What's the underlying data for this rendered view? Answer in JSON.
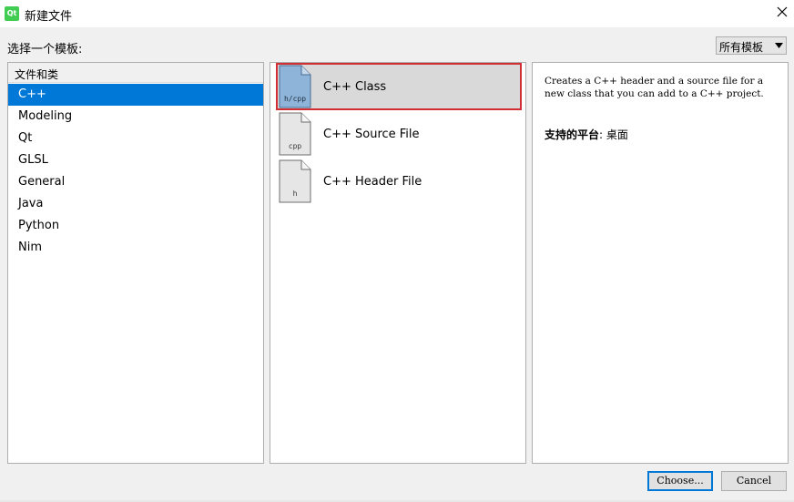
{
  "window": {
    "title": "新建文件",
    "app_icon_text": "Qt"
  },
  "toolbar": {
    "select_label": "选择一个模板:",
    "filter_value": "所有模板"
  },
  "categories": {
    "header": "文件和类",
    "items": [
      {
        "label": "C++",
        "selected": true
      },
      {
        "label": "Modeling"
      },
      {
        "label": "Qt"
      },
      {
        "label": "GLSL"
      },
      {
        "label": "General"
      },
      {
        "label": "Java"
      },
      {
        "label": "Python"
      },
      {
        "label": "Nim"
      }
    ]
  },
  "templates": {
    "items": [
      {
        "label": "C++ Class",
        "icon_text": "h/cpp",
        "icon": "cpp-class-file-icon",
        "selected": true
      },
      {
        "label": "C++ Source File",
        "icon_text": "cpp",
        "icon": "cpp-source-file-icon"
      },
      {
        "label": "C++ Header File",
        "icon_text": "h",
        "icon": "cpp-header-file-icon"
      }
    ]
  },
  "description": {
    "text": "Creates a C++ header and a source file for a new class that you can add to a C++ project.",
    "platform_label": "支持的平台",
    "platform_value": ": 桌面"
  },
  "buttons": {
    "choose": "Choose...",
    "cancel": "Cancel"
  },
  "colors": {
    "selection": "#0078d7",
    "highlight_border": "#d22e36",
    "selected_icon": "#8fb4d9"
  }
}
